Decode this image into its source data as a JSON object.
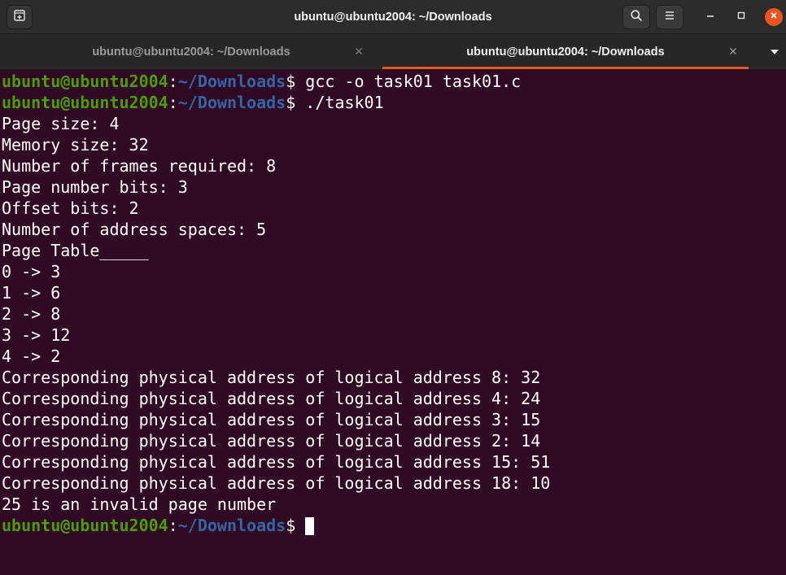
{
  "window": {
    "title": "ubuntu@ubuntu2004: ~/Downloads"
  },
  "tabs": [
    {
      "label": "ubuntu@ubuntu2004: ~/Downloads",
      "active": false
    },
    {
      "label": "ubuntu@ubuntu2004: ~/Downloads",
      "active": true
    }
  ],
  "icons": {
    "new_tab": "new-tab-icon",
    "search": "search-icon",
    "menu": "hamburger-menu-icon",
    "minimize": "minimize-icon",
    "maximize": "maximize-icon",
    "close": "close-icon",
    "tab_close": "close-icon",
    "tab_list": "chevron-down-icon"
  },
  "colors": {
    "terminal_bg": "#300a24",
    "prompt_user": "#4e9a06",
    "prompt_path": "#3465a4",
    "text": "#ffffff",
    "accent": "#e95420",
    "headerbar": "#2c2c2c"
  },
  "prompt": {
    "user_host": "ubuntu@ubuntu2004",
    "colon": ":",
    "path": "~/Downloads",
    "dollar": "$ "
  },
  "commands": [
    "gcc -o task01 task01.c",
    "./task01"
  ],
  "output": [
    "Page size: 4",
    "Memory size: 32",
    "Number of frames required: 8",
    "Page number bits: 3",
    "Offset bits: 2",
    "Number of address spaces: 5",
    "Page Table_____",
    "0 -> 3",
    "1 -> 6",
    "2 -> 8",
    "3 -> 12",
    "4 -> 2",
    "Corresponding physical address of logical address 8: 32",
    "Corresponding physical address of logical address 4: 24",
    "Corresponding physical address of logical address 3: 15",
    "Corresponding physical address of logical address 2: 14",
    "Corresponding physical address of logical address 15: 51",
    "Corresponding physical address of logical address 18: 10",
    "25 is an invalid page number"
  ]
}
